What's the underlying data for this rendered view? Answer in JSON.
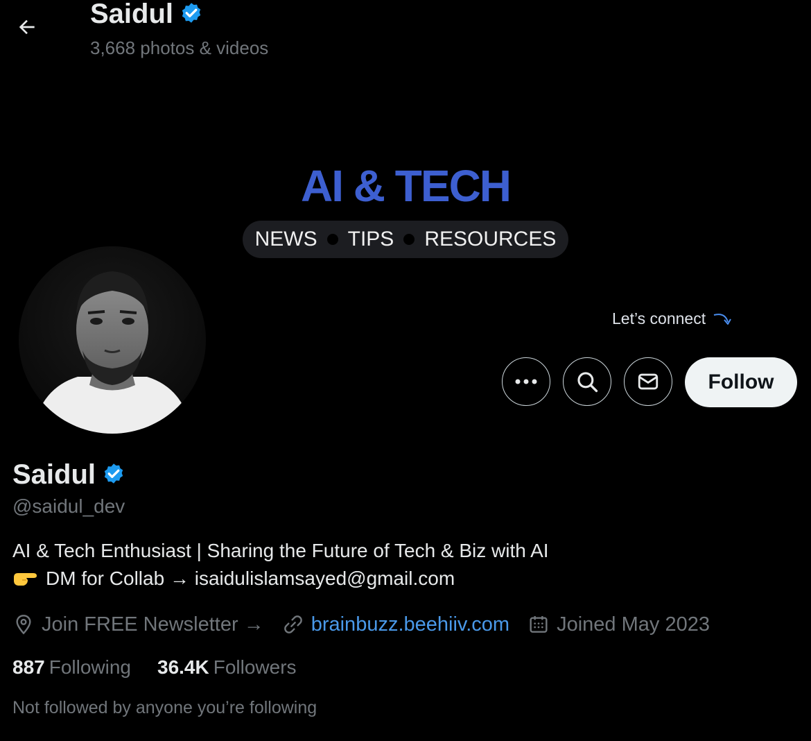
{
  "header": {
    "name": "Saidul",
    "media_count": "3,668 photos & videos"
  },
  "banner": {
    "title": "AI & TECH",
    "pill_items": [
      "NEWS",
      "TIPS",
      "RESOURCES"
    ],
    "cta": "Let’s connect",
    "title_color": "#3d5fd0"
  },
  "actions": {
    "more_icon": "more-dots-icon",
    "search_icon": "search-icon",
    "message_icon": "envelope-icon",
    "follow_label": "Follow"
  },
  "profile": {
    "name": "Saidul",
    "verified": true,
    "handle": "@saidul_dev",
    "bio_line1": "AI & Tech Enthusiast | Sharing the Future of Tech & Biz with AI",
    "bio_line2": "DM for Collab → isaidulislamsayed@gmail.com",
    "location": "Join FREE Newsletter →",
    "website": "brainbuzz.beehiiv.com",
    "joined": "Joined May 2023",
    "following_count": "887",
    "following_label": "Following",
    "followers_count": "36.4K",
    "followers_label": "Followers",
    "not_followed": "Not followed by anyone you’re following"
  },
  "colors": {
    "background": "#000000",
    "verified": "#1d9bf0",
    "link": "#4a99e9",
    "muted": "#71767b"
  }
}
